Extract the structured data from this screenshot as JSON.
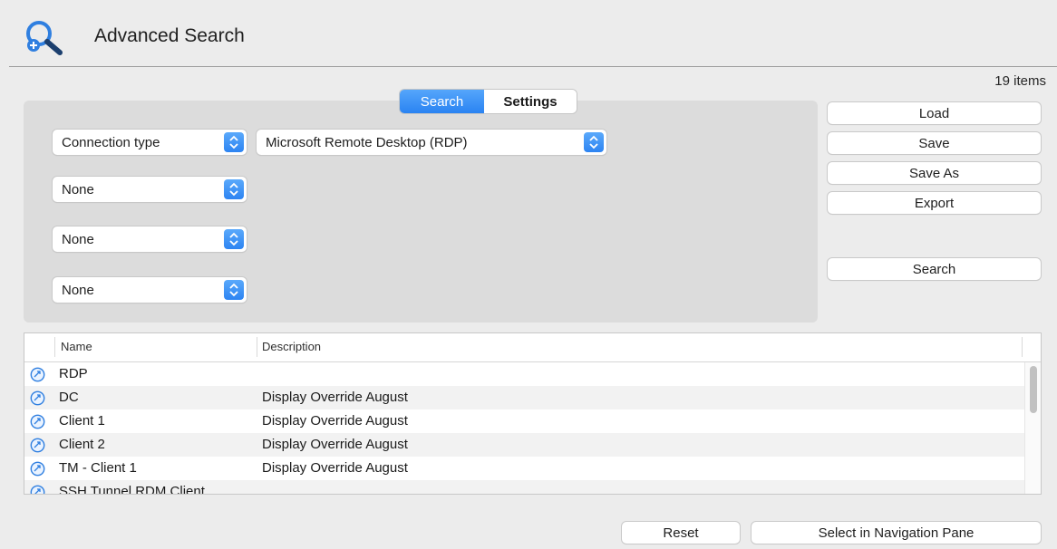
{
  "header": {
    "title": "Advanced Search",
    "icon": "search-add-icon"
  },
  "summary": {
    "item_count": "19 items"
  },
  "tabs": [
    {
      "label": "Search",
      "active": true
    },
    {
      "label": "Settings",
      "active": false
    }
  ],
  "criteria": {
    "field1": "Connection type",
    "value1": "Microsoft Remote Desktop (RDP)",
    "field2": "None",
    "field3": "None",
    "field4": "None"
  },
  "actions": {
    "load": "Load",
    "save": "Save",
    "save_as": "Save As",
    "export": "Export",
    "search": "Search"
  },
  "results": {
    "columns": [
      "Name",
      "Description"
    ],
    "rows": [
      {
        "name": "RDP",
        "description": ""
      },
      {
        "name": "DC",
        "description": "Display Override August"
      },
      {
        "name": "Client 1",
        "description": "Display Override August"
      },
      {
        "name": "Client 2",
        "description": "Display Override August"
      },
      {
        "name": "TM - Client 1",
        "description": "Display Override August"
      },
      {
        "name": "SSH Tunnel RDM Client",
        "description": ""
      }
    ]
  },
  "footer": {
    "reset": "Reset",
    "select_in_nav": "Select in Navigation Pane"
  },
  "colors": {
    "accent": "#2a83f2",
    "panel": "#dcdcdc",
    "background": "#ececec"
  }
}
